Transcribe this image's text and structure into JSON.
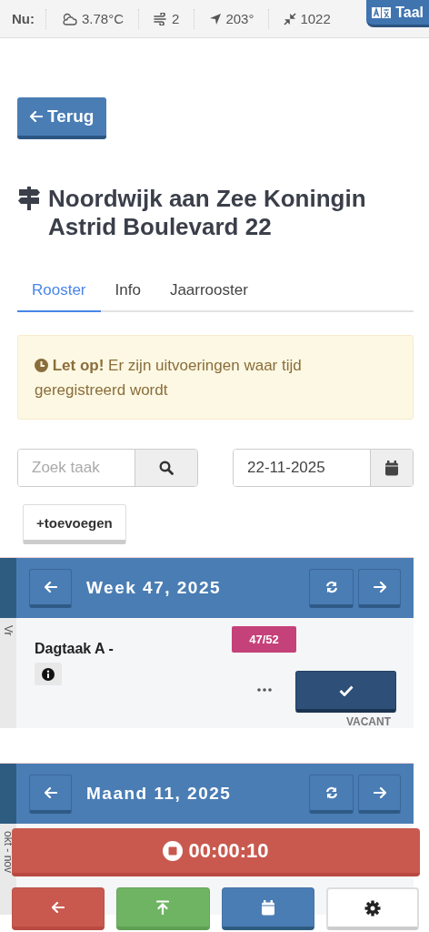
{
  "weather_bar": {
    "label": "Nu:",
    "items": [
      {
        "kind": "temperature",
        "value": "3.78°C"
      },
      {
        "kind": "wind",
        "value": "2"
      },
      {
        "kind": "direction",
        "value": "203°"
      },
      {
        "kind": "pressure",
        "value": "1022"
      }
    ],
    "language_button": "Taal"
  },
  "back_button": "Terug",
  "title": "Noordwijk aan Zee Koningin Astrid Boulevard 22",
  "tabs": [
    {
      "label": "Rooster",
      "selected": true
    },
    {
      "label": "Info",
      "selected": false
    },
    {
      "label": "Jaarrooster",
      "selected": false
    }
  ],
  "alert": {
    "text": "**Let op!** Er zijn uitvoeringen waar tijd geregistreerd wordt"
  },
  "search": {
    "placeholder": "Zoek taak"
  },
  "date": {
    "value": "22-11-2025"
  },
  "add_button": "+toevoegen",
  "sections": [
    {
      "kind": "week",
      "title": "Week 47, 2025",
      "side_label": "Vr",
      "tasks": [
        {
          "name": "Dagtaak A -",
          "counter": "47/52",
          "status": "VACANT"
        }
      ]
    },
    {
      "kind": "month",
      "title": "Maand 11, 2025",
      "side_label": "okt - nov"
    }
  ],
  "timer": {
    "time": "00:00:10"
  },
  "bottom_nav": [
    {
      "kind": "back"
    },
    {
      "kind": "top"
    },
    {
      "kind": "calendar"
    },
    {
      "kind": "settings"
    }
  ]
}
